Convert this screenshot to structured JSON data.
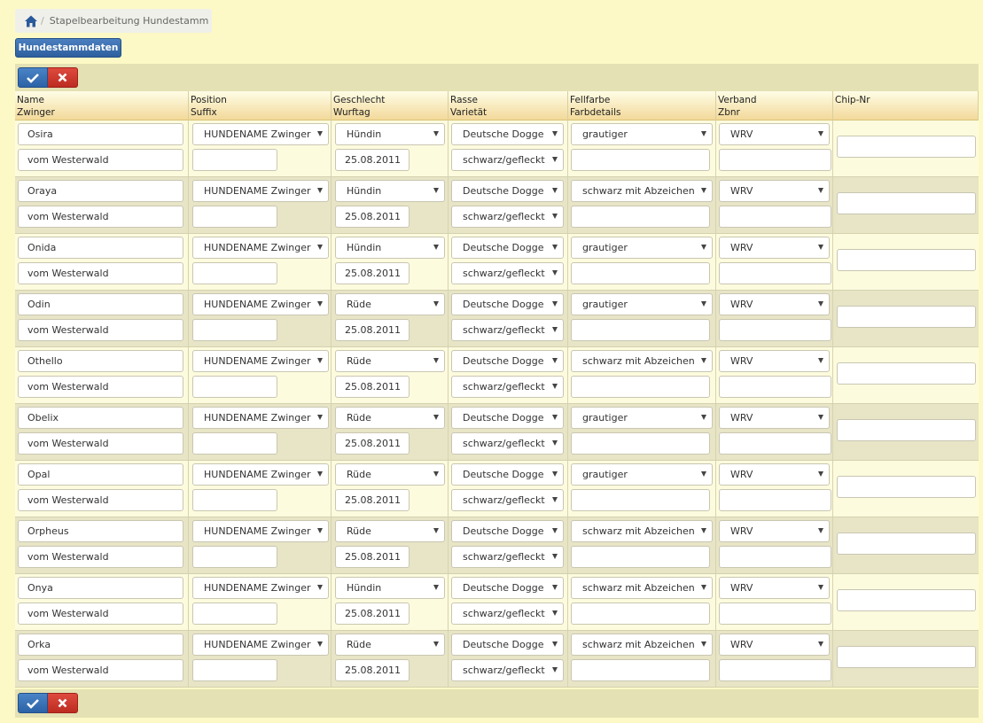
{
  "breadcrumb": {
    "current": "Stapelbearbeitung Hundestamm"
  },
  "buttons": {
    "hundestammdaten": "Hundestammdaten"
  },
  "columns": [
    {
      "line1": "Name",
      "line2": "Zwinger"
    },
    {
      "line1": "Position",
      "line2": "Suffix"
    },
    {
      "line1": "Geschlecht",
      "line2": "Wurftag"
    },
    {
      "line1": "Rasse",
      "line2": "Varietät"
    },
    {
      "line1": "Fellfarbe",
      "line2": "Farbdetails"
    },
    {
      "line1": "Verband",
      "line2": "Zbnr"
    },
    {
      "line1": "Chip-Nr",
      "line2": ""
    }
  ],
  "rows": [
    {
      "name": "Osira",
      "zwinger": "vom Westerwald",
      "position": "HUNDENAME Zwinger",
      "suffix": "",
      "geschlecht": "Hündin",
      "wurftag": "25.08.2011",
      "rasse": "Deutsche Dogge",
      "varietaet": "schwarz/gefleckt",
      "fellfarbe": "grautiger",
      "farbdetails": "",
      "verband": "WRV",
      "zbnr": "",
      "chip": ""
    },
    {
      "name": "Oraya",
      "zwinger": "vom Westerwald",
      "position": "HUNDENAME Zwinger",
      "suffix": "",
      "geschlecht": "Hündin",
      "wurftag": "25.08.2011",
      "rasse": "Deutsche Dogge",
      "varietaet": "schwarz/gefleckt",
      "fellfarbe": "schwarz mit Abzeichen",
      "farbdetails": "",
      "verband": "WRV",
      "zbnr": "",
      "chip": ""
    },
    {
      "name": "Onida",
      "zwinger": "vom Westerwald",
      "position": "HUNDENAME Zwinger",
      "suffix": "",
      "geschlecht": "Hündin",
      "wurftag": "25.08.2011",
      "rasse": "Deutsche Dogge",
      "varietaet": "schwarz/gefleckt",
      "fellfarbe": "grautiger",
      "farbdetails": "",
      "verband": "WRV",
      "zbnr": "",
      "chip": ""
    },
    {
      "name": "Odin",
      "zwinger": "vom Westerwald",
      "position": "HUNDENAME Zwinger",
      "suffix": "",
      "geschlecht": "Rüde",
      "wurftag": "25.08.2011",
      "rasse": "Deutsche Dogge",
      "varietaet": "schwarz/gefleckt",
      "fellfarbe": "grautiger",
      "farbdetails": "",
      "verband": "WRV",
      "zbnr": "",
      "chip": ""
    },
    {
      "name": "Othello",
      "zwinger": "vom Westerwald",
      "position": "HUNDENAME Zwinger",
      "suffix": "",
      "geschlecht": "Rüde",
      "wurftag": "25.08.2011",
      "rasse": "Deutsche Dogge",
      "varietaet": "schwarz/gefleckt",
      "fellfarbe": "schwarz mit Abzeichen",
      "farbdetails": "",
      "verband": "WRV",
      "zbnr": "",
      "chip": ""
    },
    {
      "name": "Obelix",
      "zwinger": "vom Westerwald",
      "position": "HUNDENAME Zwinger",
      "suffix": "",
      "geschlecht": "Rüde",
      "wurftag": "25.08.2011",
      "rasse": "Deutsche Dogge",
      "varietaet": "schwarz/gefleckt",
      "fellfarbe": "grautiger",
      "farbdetails": "",
      "verband": "WRV",
      "zbnr": "",
      "chip": ""
    },
    {
      "name": "Opal",
      "zwinger": "vom Westerwald",
      "position": "HUNDENAME Zwinger",
      "suffix": "",
      "geschlecht": "Rüde",
      "wurftag": "25.08.2011",
      "rasse": "Deutsche Dogge",
      "varietaet": "schwarz/gefleckt",
      "fellfarbe": "grautiger",
      "farbdetails": "",
      "verband": "WRV",
      "zbnr": "",
      "chip": ""
    },
    {
      "name": "Orpheus",
      "zwinger": "vom Westerwald",
      "position": "HUNDENAME Zwinger",
      "suffix": "",
      "geschlecht": "Rüde",
      "wurftag": "25.08.2011",
      "rasse": "Deutsche Dogge",
      "varietaet": "schwarz/gefleckt",
      "fellfarbe": "schwarz mit Abzeichen",
      "farbdetails": "",
      "verband": "WRV",
      "zbnr": "",
      "chip": ""
    },
    {
      "name": "Onya",
      "zwinger": "vom Westerwald",
      "position": "HUNDENAME Zwinger",
      "suffix": "",
      "geschlecht": "Hündin",
      "wurftag": "25.08.2011",
      "rasse": "Deutsche Dogge",
      "varietaet": "schwarz/gefleckt",
      "fellfarbe": "schwarz mit Abzeichen",
      "farbdetails": "",
      "verband": "WRV",
      "zbnr": "",
      "chip": ""
    },
    {
      "name": "Orka",
      "zwinger": "vom Westerwald",
      "position": "HUNDENAME Zwinger",
      "suffix": "",
      "geschlecht": "Rüde",
      "wurftag": "25.08.2011",
      "rasse": "Deutsche Dogge",
      "varietaet": "schwarz/gefleckt",
      "fellfarbe": "schwarz mit Abzeichen",
      "farbdetails": "",
      "verband": "WRV",
      "zbnr": "",
      "chip": ""
    }
  ]
}
